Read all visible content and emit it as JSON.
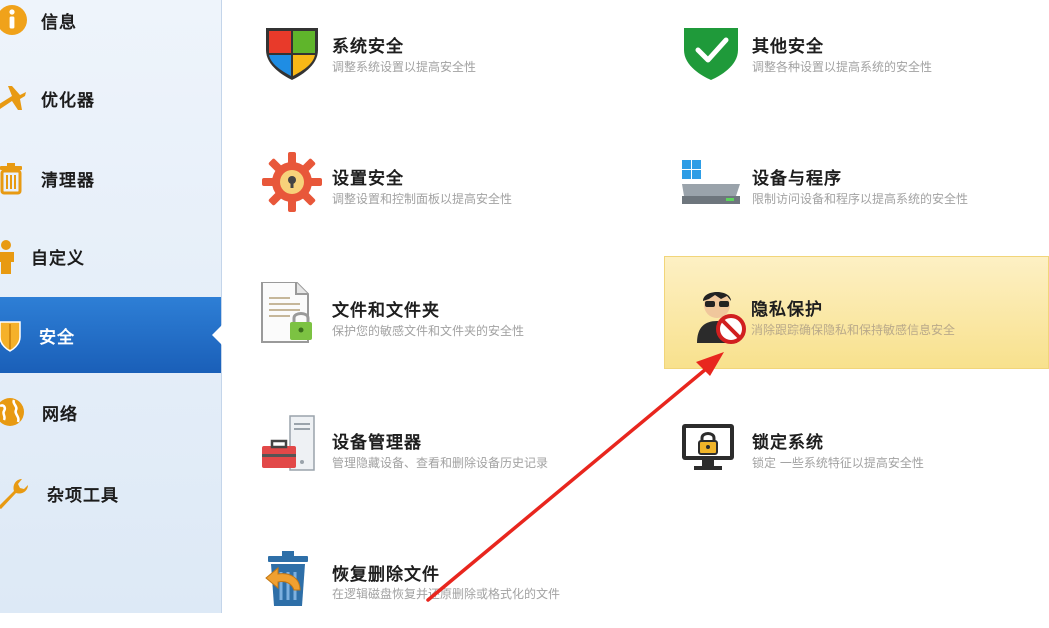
{
  "sidebar": {
    "items": [
      {
        "label": "信息",
        "icon": "info-icon"
      },
      {
        "label": "优化器",
        "icon": "airplane-icon"
      },
      {
        "label": "清理器",
        "icon": "trash-can-icon"
      },
      {
        "label": "自定义",
        "icon": "person-icon"
      },
      {
        "label": "安全",
        "icon": "shield-icon",
        "active": true
      },
      {
        "label": "网络",
        "icon": "globe-icon"
      },
      {
        "label": "杂项工具",
        "icon": "wrench-icon"
      }
    ]
  },
  "main": {
    "tiles": [
      {
        "title": "系统安全",
        "desc": "调整系统设置以提高安全性",
        "icon": "windows-shield-icon"
      },
      {
        "title": "其他安全",
        "desc": "调整各种设置以提高系统的安全性",
        "icon": "green-shield-check-icon"
      },
      {
        "title": "设置安全",
        "desc": "调整设置和控制面板以提高安全性",
        "icon": "gear-lock-icon"
      },
      {
        "title": "设备与程序",
        "desc": "限制访问设备和程序以提高系统的安全性",
        "icon": "drive-windows-icon"
      },
      {
        "title": "文件和文件夹",
        "desc": "保护您的敏感文件和文件夹的安全性",
        "icon": "document-lock-icon"
      },
      {
        "title": "隐私保护",
        "desc": "消除跟踪确保隐私和保持敏感信息安全",
        "icon": "privacy-person-icon",
        "highlighted": true
      },
      {
        "title": "设备管理器",
        "desc": "管理隐藏设备、查看和删除设备历史记录",
        "icon": "device-toolbox-icon"
      },
      {
        "title": "锁定系统",
        "desc": "锁定 一些系统特征以提高安全性",
        "icon": "monitor-lock-icon"
      },
      {
        "title": "恢复删除文件",
        "desc": "在逻辑磁盘恢复并还原删除或格式化的文件",
        "icon": "restore-trash-icon"
      }
    ]
  },
  "colors": {
    "sidebar_active": "#1f6cc6",
    "highlight_tile": "#f8e18d",
    "annotation_arrow": "#e8261e"
  }
}
